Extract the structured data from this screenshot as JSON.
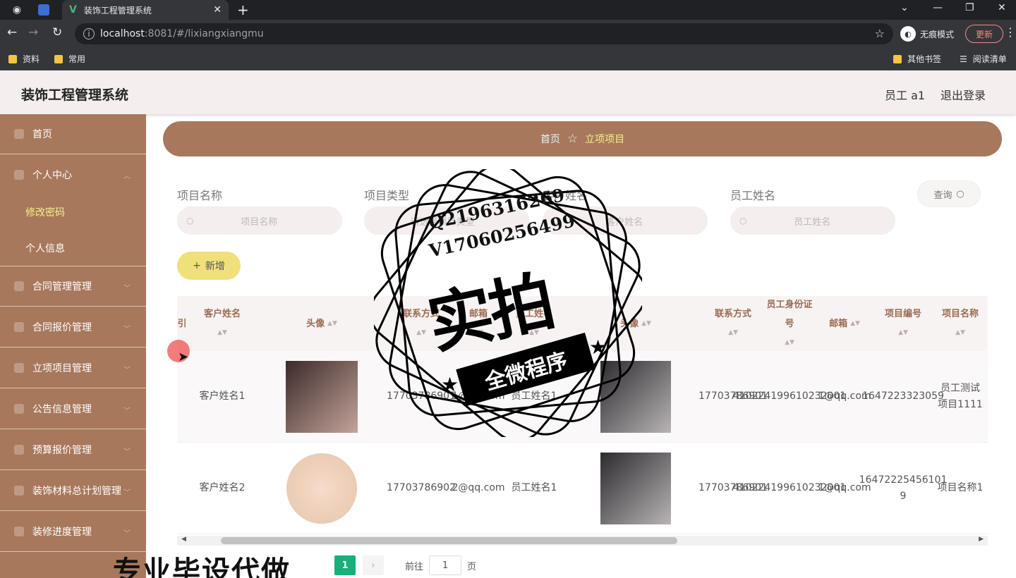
{
  "browser": {
    "tab_title": "装饰工程管理系统",
    "url_host": "localhost",
    "url_rest": ":8081/#/lixiangxiangmu",
    "incognito_label": "无痕模式",
    "update_label": "更新",
    "bookmarks": [
      "资料",
      "常用"
    ],
    "bookmarks_right": [
      "其他书签",
      "阅读清单"
    ]
  },
  "header": {
    "title": "装饰工程管理系统",
    "user": "员工 a1",
    "logout": "退出登录"
  },
  "sidebar": {
    "items": [
      {
        "label": "首页",
        "icon": "home-icon"
      },
      {
        "label": "个人中心",
        "icon": "user-icon"
      },
      {
        "label": "合同管理管理",
        "icon": "contract-icon"
      },
      {
        "label": "合同报价管理",
        "icon": "quote-icon"
      },
      {
        "label": "立项项目管理",
        "icon": "project-icon"
      },
      {
        "label": "公告信息管理",
        "icon": "notice-icon"
      },
      {
        "label": "预算报价管理",
        "icon": "budget-icon"
      },
      {
        "label": "装饰材料总计划管理",
        "icon": "material-icon"
      },
      {
        "label": "装修进度管理",
        "icon": "progress-icon"
      }
    ],
    "sub_items": [
      "修改密码",
      "个人信息"
    ]
  },
  "breadcrumb": {
    "home": "首页",
    "current": "立项项目"
  },
  "filters": [
    {
      "label": "项目名称",
      "placeholder": "项目名称"
    },
    {
      "label": "项目类型",
      "placeholder": "请选择项目类型"
    },
    {
      "label": "客户姓名",
      "placeholder": "客户姓名"
    },
    {
      "label": "员工姓名",
      "placeholder": "员工姓名"
    }
  ],
  "query_label": "查询",
  "add_label": "新增",
  "table": {
    "columns": [
      "引",
      "客户姓名",
      "头像",
      "联系方式",
      "邮箱",
      "员工姓名",
      "头像",
      "联系方式",
      "员工身份证号",
      "邮箱",
      "项目编号",
      "项目名称"
    ],
    "rows": [
      {
        "customer_name": "客户姓名1",
        "customer_phone": "17703786901",
        "customer_email": "1@qq.com",
        "employee_name": "员工姓名1",
        "employee_phone": "17703786901",
        "employee_id": "410224199610232001",
        "employee_email": "1@qq.com",
        "project_no": "1647223323059",
        "project_name": "员工测试项目1111"
      },
      {
        "customer_name": "客户姓名2",
        "customer_phone": "17703786902",
        "customer_email": "2@qq.com",
        "employee_name": "员工姓名1",
        "employee_phone": "17703786901",
        "employee_id": "410224199610232001",
        "employee_email": "1@qq.com",
        "project_no": "16472225456101 9",
        "project_name": "项目名称1"
      }
    ]
  },
  "pagination": {
    "current": "1",
    "goto_label": "前往",
    "goto_value": "1",
    "page_unit": "页"
  },
  "watermark": {
    "qq": "Q2196316269",
    "vx": "V17060256499",
    "big": "实拍",
    "ribbon": "全微程序",
    "banner": "专业毕设代做"
  }
}
